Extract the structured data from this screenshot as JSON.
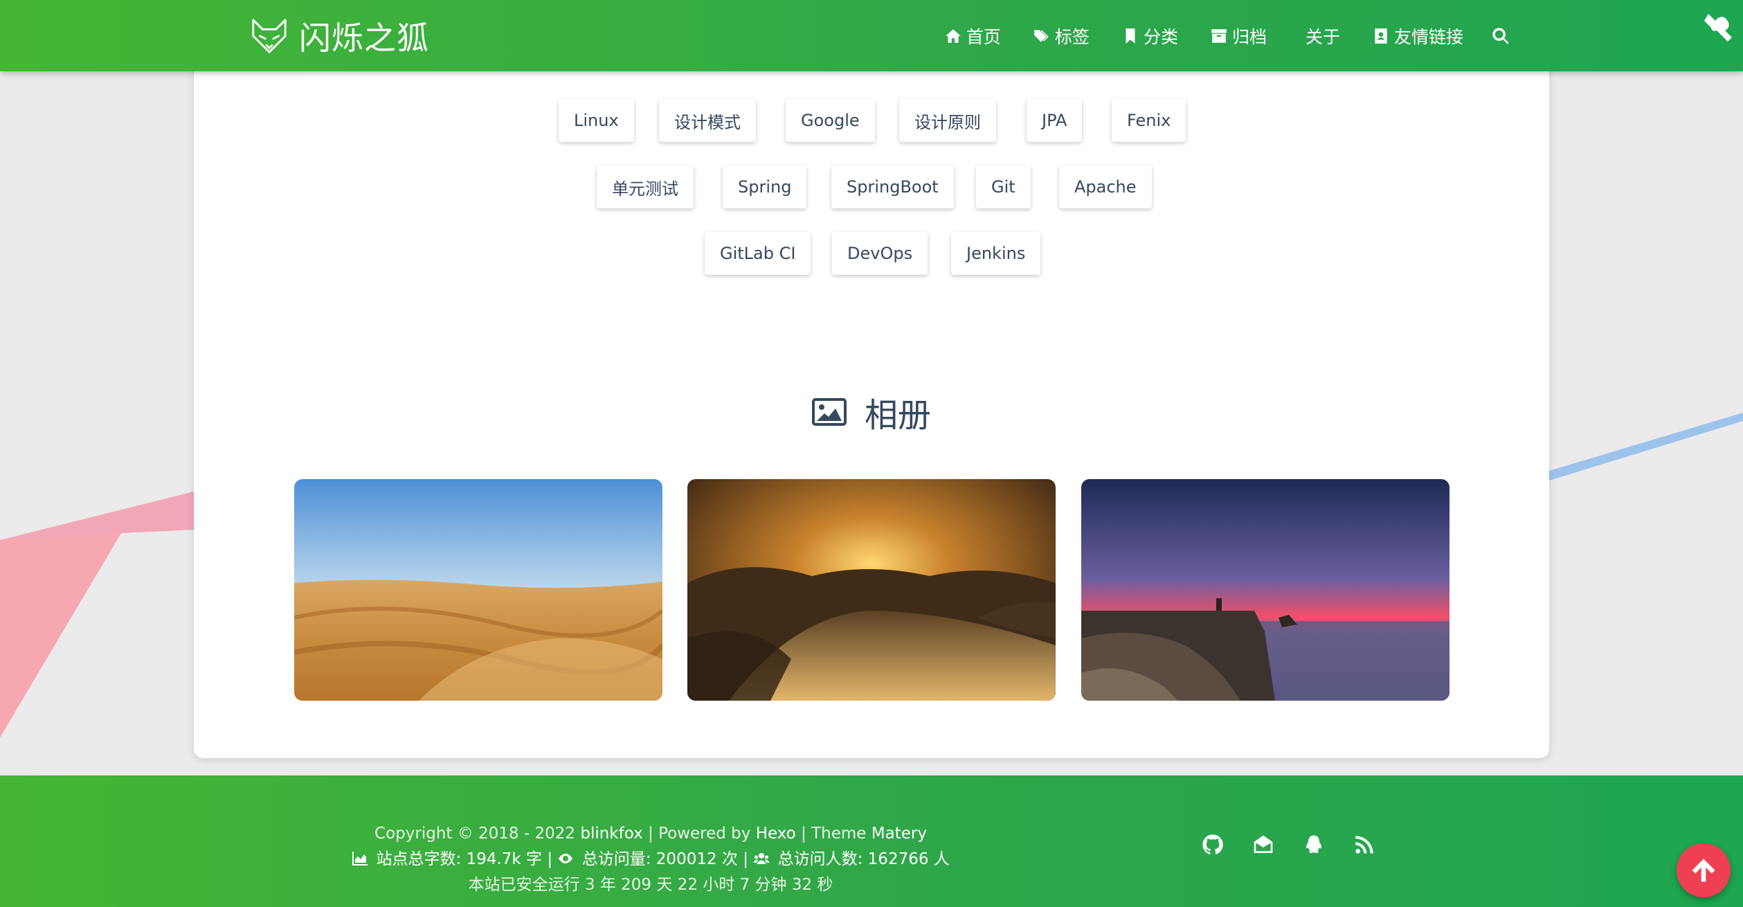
{
  "header": {
    "site_name": "闪烁之狐",
    "nav": [
      {
        "label": "首页",
        "icon": "home-icon"
      },
      {
        "label": "标签",
        "icon": "tags-icon"
      },
      {
        "label": "分类",
        "icon": "bookmark-icon"
      },
      {
        "label": "归档",
        "icon": "archive-icon"
      },
      {
        "label": "关于",
        "icon": ""
      },
      {
        "label": "友情链接",
        "icon": "address-book-icon"
      }
    ],
    "search_icon": "search-icon",
    "corner_icon": "github-cat-corner-icon"
  },
  "tags": {
    "row1": [
      "Linux",
      "设计模式",
      "Google",
      "设计原则",
      "JPA",
      "Fenix"
    ],
    "row2": [
      "单元测试",
      "Spring",
      "SpringBoot",
      "Git",
      "Apache"
    ],
    "row3": [
      "GitLab CI",
      "DevOps",
      "Jenkins"
    ]
  },
  "album": {
    "title": "相册",
    "icon": "image-icon",
    "photos": [
      "desert-dunes-photo",
      "sunset-dunes-photo",
      "coastal-cliff-dusk-photo"
    ]
  },
  "footer": {
    "copyright_prefix": "Copyright © 2018 - 2022",
    "author": "blinkfox",
    "powered_prefix": "| Powered by",
    "powered": "Hexo",
    "theme_prefix": "| Theme",
    "theme": "Matery",
    "word_count_label": "站点总字数:",
    "word_count": "194.7k",
    "word_count_unit": "字 |",
    "pv_label": "总访问量:",
    "pv": "200012",
    "pv_unit": "次 |",
    "uv_label": "总访问人数:",
    "uv": "162766",
    "uv_unit": "人",
    "runtime_text": "本站已安全运行 3 年 209 天 22 小时 7 分钟 32 秒",
    "social": [
      "github-icon",
      "email-icon",
      "qq-icon",
      "rss-icon"
    ]
  },
  "colors": {
    "brand_green": "#2ea64a",
    "text_dark": "#34495e",
    "back_to_top": "#ef3f52"
  }
}
